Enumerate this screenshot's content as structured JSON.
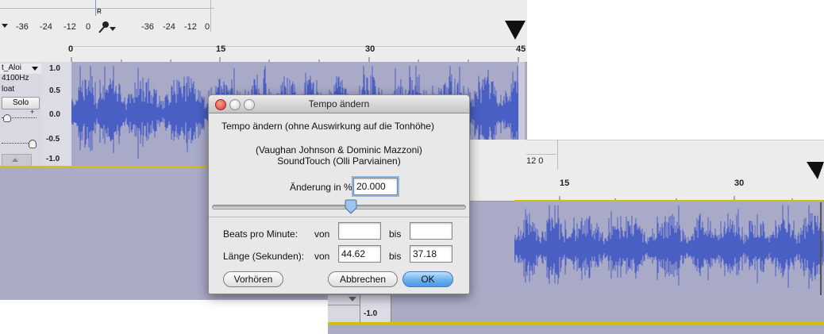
{
  "left_window": {
    "meter_input_labels": [
      "-36",
      "-24",
      "-12",
      "0"
    ],
    "meter_output_labels": [
      "-36",
      "-24",
      "-12",
      "0"
    ],
    "meter_channel_label": "R",
    "ruler_labels": [
      "0",
      "15",
      "30",
      "45"
    ],
    "track": {
      "name": "t_Aloi",
      "rate": "4100Hz",
      "format": "loat",
      "solo_label": "Solo"
    },
    "scale_labels": [
      "1.0",
      "0.5",
      "0.0",
      "-0.5",
      "-1.0"
    ]
  },
  "right_window": {
    "meter_label": "12  0",
    "ruler_labels": [
      "15",
      "30"
    ],
    "scale_label": "-1.0"
  },
  "dialog": {
    "title": "Tempo ändern",
    "description": "Tempo ändern (ohne Auswirkung auf die Tonhöhe)",
    "credits_line1": "(Vaughan Johnson & Dominic Mazzoni)",
    "credits_line2": "SoundTouch (Olli Parviainen)",
    "change_label": "Änderung in %:",
    "change_value": "20.000",
    "slider_value_percent": 20,
    "bpm_label": "Beats pro Minute:",
    "from_label": "von",
    "to_label": "bis",
    "bpm_from": "",
    "bpm_to": "",
    "length_label": "Länge (Sekunden):",
    "length_from": "44.62",
    "length_to": "37.18",
    "preview_button": "Vorhören",
    "cancel_button": "Abbrechen",
    "ok_button": "OK"
  },
  "colors": {
    "waveform": "#4a5fc4",
    "track_bg": "#a9a9c8",
    "selection_line": "#d6c100",
    "close_button": "#e0443a",
    "default_button": "#6bb1ee"
  }
}
